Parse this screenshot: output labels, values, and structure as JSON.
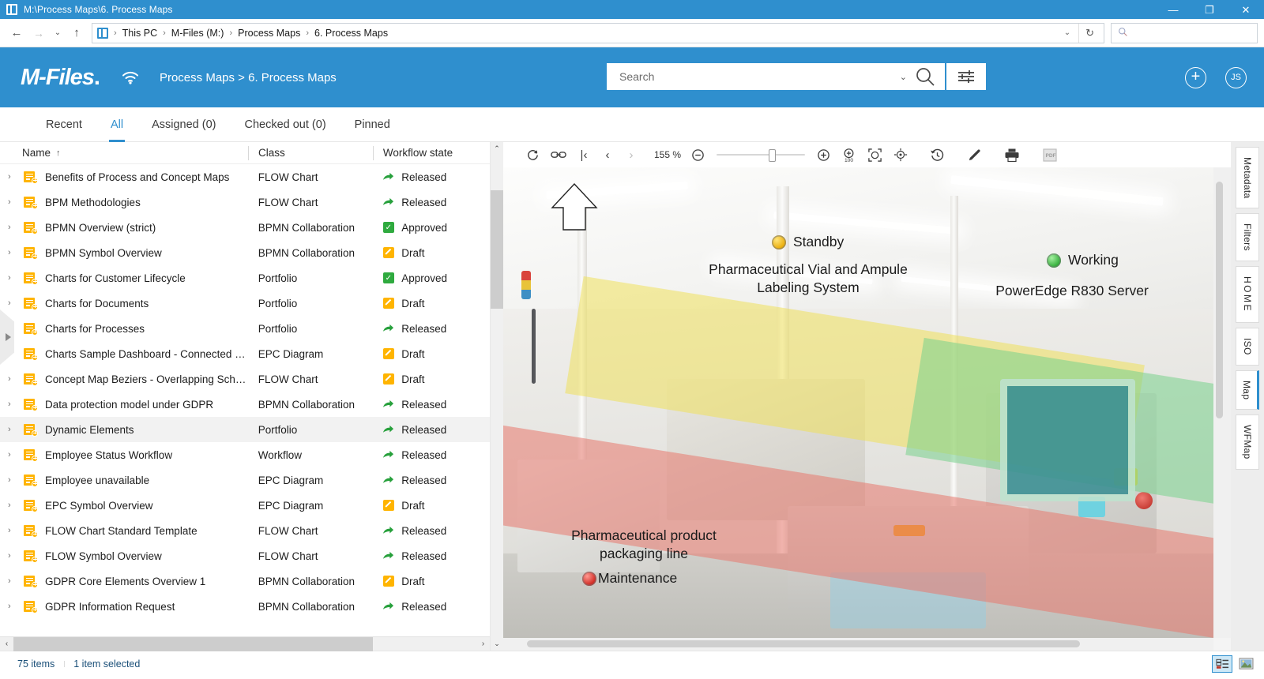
{
  "window": {
    "title": "M:\\Process Maps\\6. Process Maps",
    "icon": "mfiles-vault-icon",
    "minimize_label": "—",
    "maximize_label": "❐",
    "close_label": "✕"
  },
  "address_bar": {
    "back_label": "←",
    "forward_label": "→",
    "recent_label": "⌄",
    "up_label": "↑",
    "breadcrumbs": [
      "This PC",
      "M-Files (M:)",
      "Process Maps",
      "6. Process Maps"
    ],
    "separator": "›",
    "dropdown_label": "⌄",
    "refresh_label": "↻",
    "search_placeholder": ""
  },
  "mfiles_header": {
    "logo": "M-Files",
    "logo_dot": ".",
    "wifi_icon": "wifi-icon",
    "breadcrumb": "Process Maps > 6. Process Maps",
    "search_placeholder": "Search",
    "search_value": "",
    "search_chevron": "⌄",
    "filter_icon": "sliders-icon",
    "create_label": "+",
    "user_initials": "JS"
  },
  "tabs": [
    {
      "label": "Recent",
      "active": false
    },
    {
      "label": "All",
      "active": true
    },
    {
      "label": "Assigned (0)",
      "active": false
    },
    {
      "label": "Checked out (0)",
      "active": false
    },
    {
      "label": "Pinned",
      "active": false
    }
  ],
  "list": {
    "columns": {
      "name": "Name",
      "sort_indicator": "↑",
      "class": "Class",
      "workflow_state": "Workflow state"
    },
    "rows": [
      {
        "name": "Benefits of Process and Concept Maps",
        "class": "FLOW Chart",
        "state": "Released",
        "state_type": "released",
        "selected": false
      },
      {
        "name": "BPM Methodologies",
        "class": "FLOW Chart",
        "state": "Released",
        "state_type": "released",
        "selected": false
      },
      {
        "name": "BPMN Overview (strict)",
        "class": "BPMN Collaboration",
        "state": "Approved",
        "state_type": "approved",
        "selected": false
      },
      {
        "name": "BPMN Symbol Overview",
        "class": "BPMN Collaboration",
        "state": "Draft",
        "state_type": "draft",
        "selected": false
      },
      {
        "name": "Charts for Customer Lifecycle",
        "class": "Portfolio",
        "state": "Approved",
        "state_type": "approved",
        "selected": false
      },
      {
        "name": "Charts for Documents",
        "class": "Portfolio",
        "state": "Draft",
        "state_type": "draft",
        "selected": false
      },
      {
        "name": "Charts for Processes",
        "class": "Portfolio",
        "state": "Released",
        "state_type": "released",
        "selected": false
      },
      {
        "name": "Charts Sample Dashboard - Connected S...",
        "class": "EPC Diagram",
        "state": "Draft",
        "state_type": "draft",
        "selected": false
      },
      {
        "name": "Concept Map Beziers - Overlapping Sched...",
        "class": "FLOW Chart",
        "state": "Draft",
        "state_type": "draft",
        "selected": false
      },
      {
        "name": "Data protection model under GDPR",
        "class": "BPMN Collaboration",
        "state": "Released",
        "state_type": "released",
        "selected": false
      },
      {
        "name": "Dynamic Elements",
        "class": "Portfolio",
        "state": "Released",
        "state_type": "released",
        "selected": true
      },
      {
        "name": "Employee Status Workflow",
        "class": "Workflow",
        "state": "Released",
        "state_type": "released",
        "selected": false
      },
      {
        "name": "Employee unavailable",
        "class": "EPC Diagram",
        "state": "Released",
        "state_type": "released",
        "selected": false
      },
      {
        "name": "EPC Symbol Overview",
        "class": "EPC Diagram",
        "state": "Draft",
        "state_type": "draft",
        "selected": false
      },
      {
        "name": "FLOW Chart Standard Template",
        "class": "FLOW Chart",
        "state": "Released",
        "state_type": "released",
        "selected": false
      },
      {
        "name": "FLOW Symbol Overview",
        "class": "FLOW Chart",
        "state": "Released",
        "state_type": "released",
        "selected": false
      },
      {
        "name": "GDPR Core Elements Overview 1",
        "class": "BPMN Collaboration",
        "state": "Draft",
        "state_type": "draft",
        "selected": false
      },
      {
        "name": "GDPR Information Request",
        "class": "BPMN Collaboration",
        "state": "Released",
        "state_type": "released",
        "selected": false
      }
    ],
    "hscroll_left": "‹",
    "hscroll_right": "›",
    "vscroll_up": "⌃",
    "vscroll_down": "⌄"
  },
  "preview_toolbar": {
    "refresh": "↻",
    "link": "link-icon",
    "first": "|‹",
    "previous": "‹",
    "next": "›",
    "zoom_level": "155 %",
    "zoom_out": "⊖",
    "zoom_in": "⊕",
    "zoom_100": "100",
    "fit_page": "fit-page-icon",
    "pan": "pan-icon",
    "history": "history-icon",
    "edit": "pencil-icon",
    "print": "printer-icon",
    "pdf": "PDF"
  },
  "preview_content": {
    "annotations": [
      {
        "id": "standby",
        "label": "Standby",
        "led": "amber"
      },
      {
        "id": "working",
        "label": "Working",
        "led": "green"
      },
      {
        "id": "maintenance",
        "label": "Maintenance",
        "led": "red"
      }
    ],
    "captions": [
      {
        "id": "vial-system",
        "line1": "Pharmaceutical Vial and Ampule",
        "line2": "Labeling System"
      },
      {
        "id": "server",
        "line1": "PowerEdge R830 Server",
        "line2": ""
      },
      {
        "id": "packaging-line",
        "line1": "Pharmaceutical product",
        "line2": "packaging line"
      }
    ]
  },
  "right_tabs": [
    {
      "label": "Metadata",
      "active": false
    },
    {
      "label": "Filters",
      "active": false
    },
    {
      "label": "HOME",
      "active": false,
      "spaced": true
    },
    {
      "label": "ISO",
      "active": false
    },
    {
      "label": "Map",
      "active": true
    },
    {
      "label": "WFMap",
      "active": false
    }
  ],
  "status_bar": {
    "item_count": "75 items",
    "selection": "1 item selected",
    "view_details_icon": "list-view-icon",
    "view_thumbnails_icon": "thumbnail-view-icon"
  },
  "colors": {
    "brand_blue": "#2f8fce",
    "released_green": "#27a03c",
    "approved_green": "#2faa3f",
    "draft_amber": "#ffb400"
  }
}
